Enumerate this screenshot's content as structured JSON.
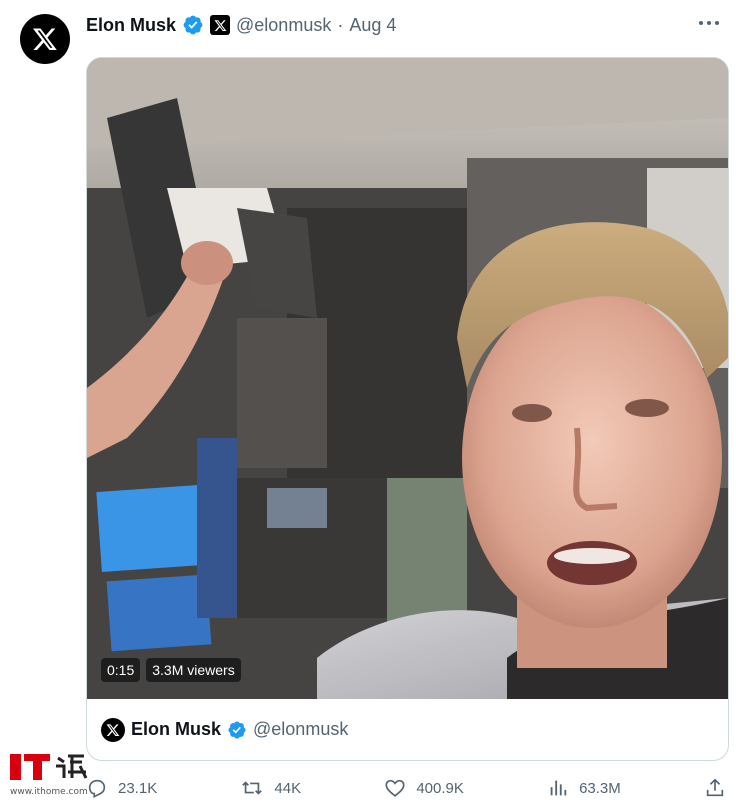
{
  "tweet": {
    "author_name": "Elon Musk",
    "handle": "@elonmusk",
    "separator": "·",
    "date": "Aug 4"
  },
  "media": {
    "duration": "0:15",
    "viewers": "3.3M viewers"
  },
  "quoted": {
    "author_name": "Elon Musk",
    "handle": "@elonmusk"
  },
  "actions": {
    "replies": "23.1K",
    "reposts": "44K",
    "likes": "400.9K",
    "views": "63.3M"
  },
  "watermark": {
    "url": "www.ithome.com"
  },
  "colors": {
    "verified": "#1d9bf0",
    "muted_text": "#536471",
    "watermark_red": "#d7000f"
  }
}
